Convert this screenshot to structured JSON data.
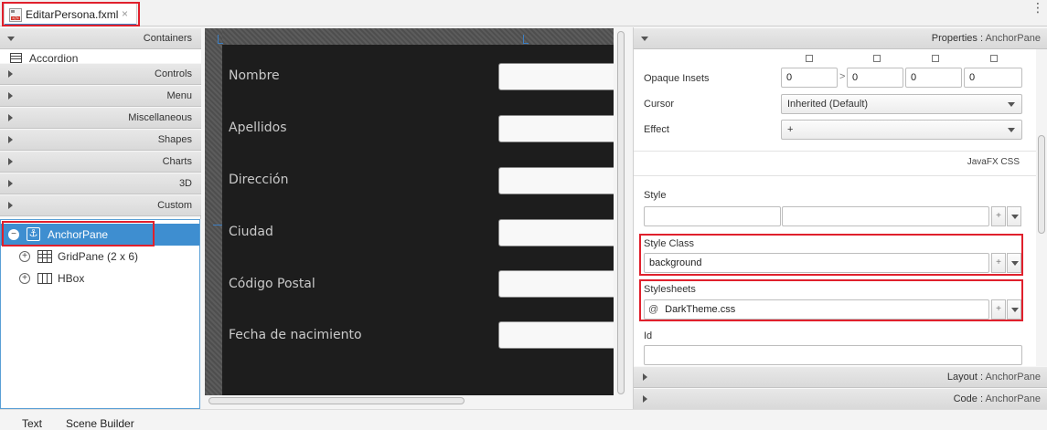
{
  "tabs": [
    {
      "title": "EditarPersona.fxml",
      "close_glyph": "×"
    }
  ],
  "library": {
    "categories": [
      {
        "label": "Containers",
        "expanded": true,
        "items": [
          "Accordion"
        ]
      },
      {
        "label": "Controls"
      },
      {
        "label": "Menu"
      },
      {
        "label": "Miscellaneous"
      },
      {
        "label": "Shapes"
      },
      {
        "label": "Charts"
      },
      {
        "label": "3D"
      },
      {
        "label": "Custom"
      }
    ]
  },
  "hierarchy": {
    "nodes": [
      {
        "label": "AnchorPane",
        "selected": true,
        "toggle": "−"
      },
      {
        "label": "GridPane (2 x 6)",
        "toggle": "+"
      },
      {
        "label": "HBox",
        "toggle": "+"
      }
    ]
  },
  "canvas": {
    "labels": [
      "Nombre",
      "Apellidos",
      "Dirección",
      "Ciudad",
      "Código Postal",
      "Fecha de nacimiento"
    ]
  },
  "inspector": {
    "properties_header": {
      "title": "Properties",
      "sep": " : ",
      "node": "AnchorPane"
    },
    "opaque_insets": {
      "label": "Opaque Insets",
      "values": [
        "0",
        "0",
        "0",
        "0"
      ],
      "link_glyph": ">"
    },
    "cursor": {
      "label": "Cursor",
      "value": "Inherited (Default)"
    },
    "effect": {
      "label": "Effect",
      "value": "+"
    },
    "css_section": "JavaFX CSS",
    "style": {
      "label": "Style",
      "add_glyph": "+"
    },
    "style_class": {
      "label": "Style Class",
      "value": "background",
      "add_glyph": "+"
    },
    "stylesheets": {
      "label": "Stylesheets",
      "prefix": "@",
      "value": "DarkTheme.css",
      "add_glyph": "+"
    },
    "id": {
      "label": "Id"
    },
    "layout_header": {
      "title": "Layout",
      "sep": " : ",
      "node": "AnchorPane"
    },
    "code_header": {
      "title": "Code",
      "sep": " : ",
      "node": "AnchorPane"
    }
  },
  "bottom_tabs": [
    "Text",
    "Scene Builder"
  ],
  "colors": {
    "accent": "#3e8ed0",
    "highlight": "#e0202c",
    "canvas_bg": "#1d1d1d"
  }
}
